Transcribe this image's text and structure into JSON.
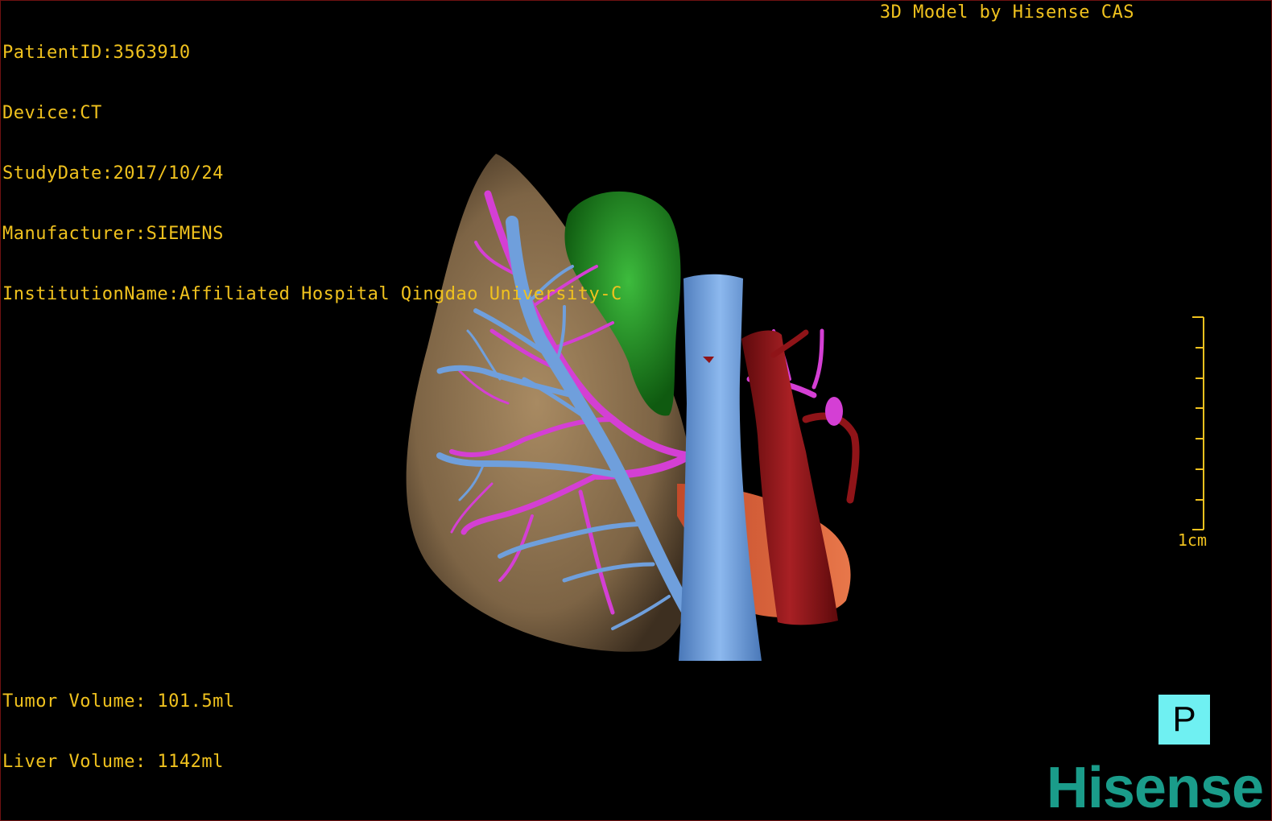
{
  "header": {
    "patient_id": "PatientID:3563910",
    "device": "Device:CT",
    "study_date": "StudyDate:2017/10/24",
    "manufacturer": "Manufacturer:SIEMENS",
    "institution": "InstitutionName:Affiliated Hospital Qingdao University-C",
    "credit": "3D Model by Hisense CAS"
  },
  "volumes": {
    "tumor": "Tumor Volume: 101.5ml",
    "liver": "Liver Volume: 1142ml"
  },
  "scale": {
    "label": "1cm"
  },
  "orientation": {
    "label": "P"
  },
  "brand": {
    "logo_text": "Hisense"
  },
  "colors": {
    "overlay_text": "#f0c21e",
    "liver": "#8b7150",
    "tumor": "#1f8a1f",
    "portal_vein": "#6f9fdc",
    "hepatic_artery": "#d43fd4",
    "aorta": "#8f1418",
    "orientation_marker": "#6ff0f2",
    "brand": "#1a9c8a"
  }
}
